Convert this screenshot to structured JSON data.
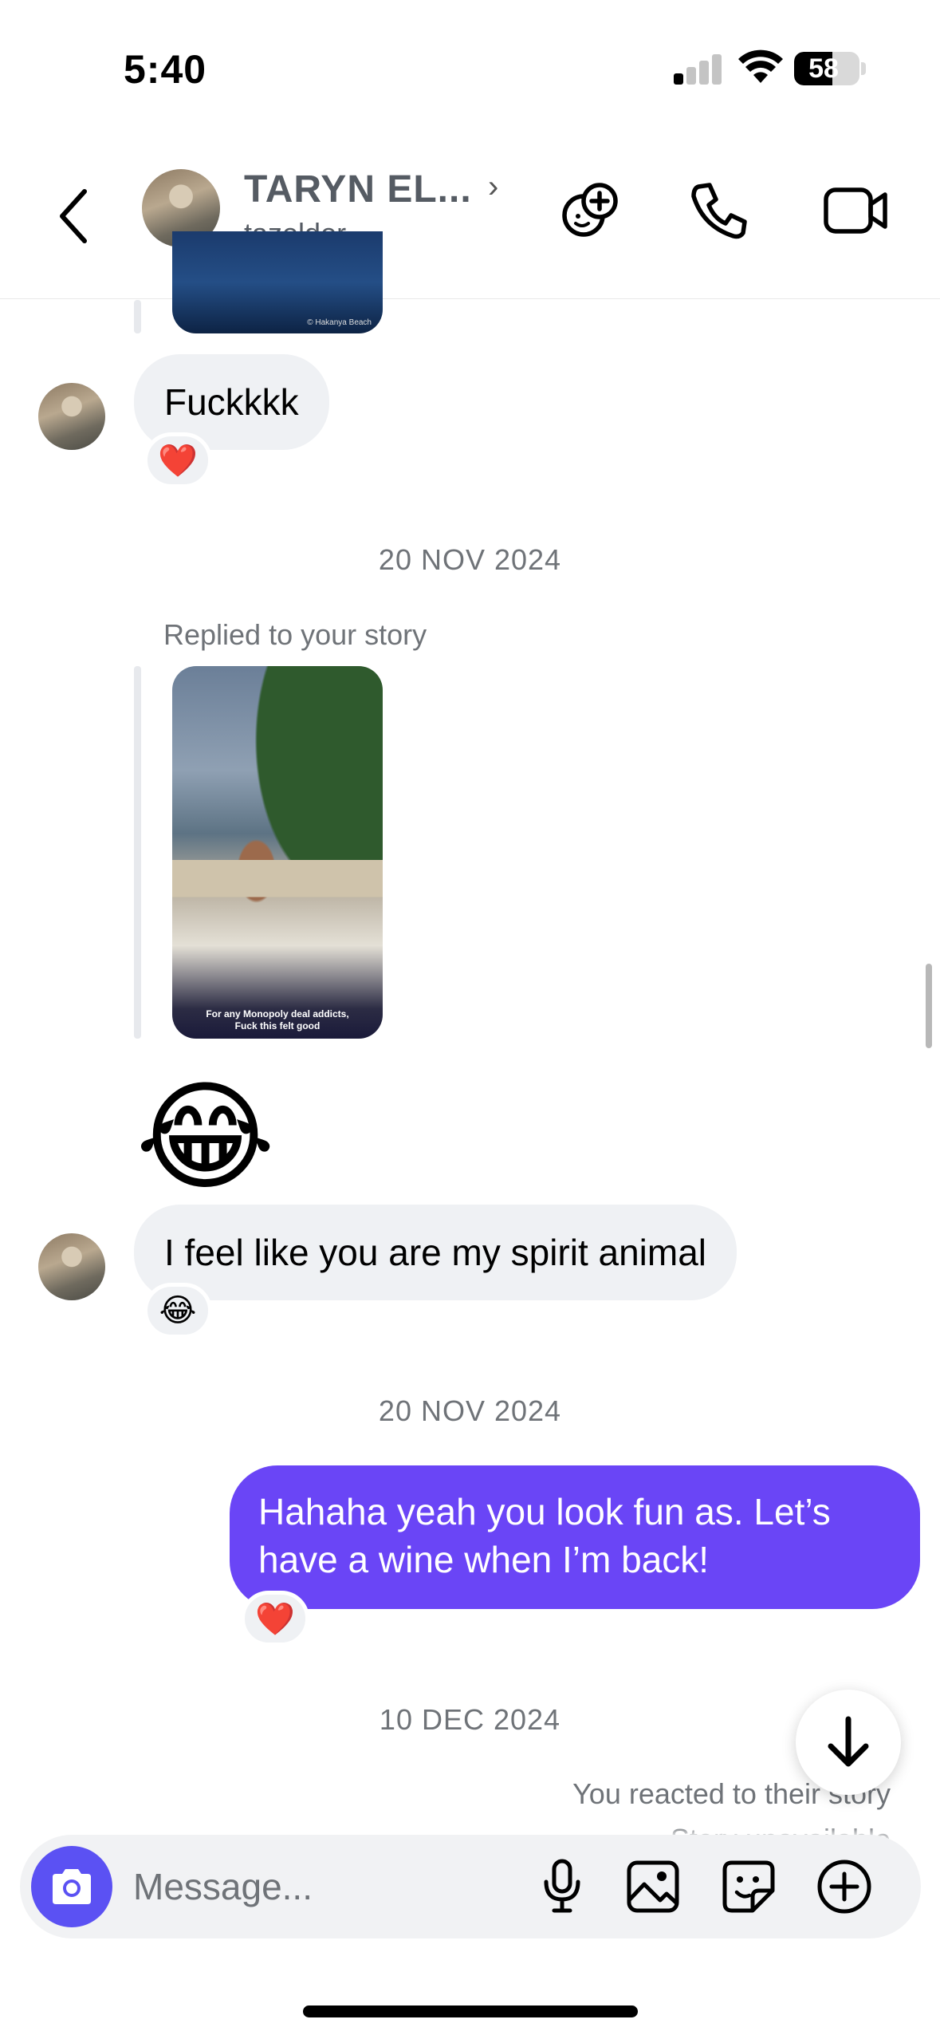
{
  "status_bar": {
    "time": "5:40",
    "battery": "58",
    "battery_fraction": 0.58
  },
  "header": {
    "name": "TARYN EL...",
    "chevron": "›",
    "username": "tazelder",
    "icons": {
      "back": "chevron-left-icon",
      "effects": "add-effect-icon",
      "call": "phone-icon",
      "video": "video-camera-icon"
    }
  },
  "thread": {
    "top_story_caption": "© Hakanya Beach",
    "msg1": {
      "text": "Fuckkkk",
      "reaction": "❤️"
    },
    "date1": "20 NOV 2024",
    "replied_label": "Replied to your story",
    "story_caption": "For any Monopoly deal addicts,\nFuck this felt good",
    "emoji_message": "😂",
    "msg2": {
      "text": "I feel like you are my spirit animal",
      "reaction": "😂"
    },
    "date2": "20 NOV 2024",
    "msg3": {
      "text": "Hahaha yeah you look fun as. Let’s have a wine when I’m back!",
      "reaction": "❤️"
    },
    "date3": "10 DEC 2024",
    "story_react": "You reacted to their story",
    "story_unavailable": "Story unavailable"
  },
  "composer": {
    "placeholder": "Message...",
    "icons": [
      "camera-icon",
      "microphone-icon",
      "gallery-icon",
      "sticker-icon",
      "plus-icon"
    ]
  },
  "colors": {
    "outgoing_bubble": "#6a45f6",
    "incoming_bubble": "#eff1f4",
    "camera_button": "#5b51f3",
    "secondary_text": "#6f7378"
  }
}
